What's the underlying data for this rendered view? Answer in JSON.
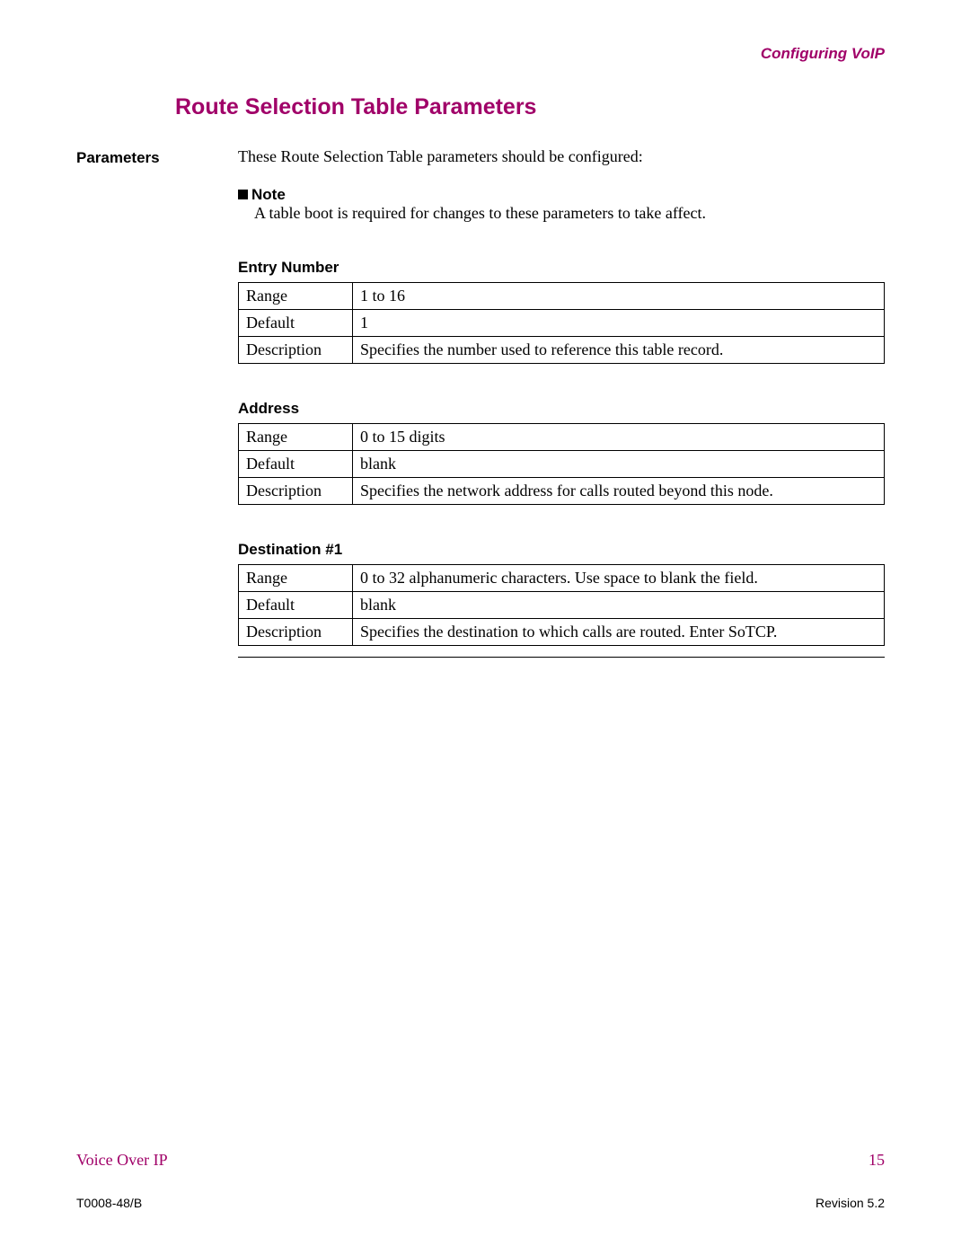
{
  "header": "Configuring VoIP",
  "title": "Route Selection Table Parameters",
  "sidebar_label": "Parameters",
  "intro": "These Route Selection Table parameters should be configured:",
  "note": {
    "label": "Note",
    "text": "A table boot is required for changes to these parameters to take affect."
  },
  "sections": [
    {
      "heading": "Entry Number",
      "rows": [
        {
          "label": "Range",
          "value": "1 to 16"
        },
        {
          "label": "Default",
          "value": "1"
        },
        {
          "label": "Description",
          "value": "Specifies the number used to reference this table record."
        }
      ]
    },
    {
      "heading": "Address",
      "rows": [
        {
          "label": "Range",
          "value": "0 to 15 digits"
        },
        {
          "label": "Default",
          "value": "blank"
        },
        {
          "label": "Description",
          "value": "Specifies the network address for calls routed beyond this node."
        }
      ]
    },
    {
      "heading": "Destination #1",
      "rows": [
        {
          "label": "Range",
          "value": "0 to 32 alphanumeric characters. Use space to blank the field."
        },
        {
          "label": "Default",
          "value": "blank"
        },
        {
          "label": "Description",
          "value": "Specifies the destination to which calls are routed. Enter SoTCP."
        }
      ]
    }
  ],
  "footer1": {
    "left": "Voice Over IP",
    "right": "15"
  },
  "footer2": {
    "left": "T0008-48/B",
    "right": "Revision 5.2"
  }
}
